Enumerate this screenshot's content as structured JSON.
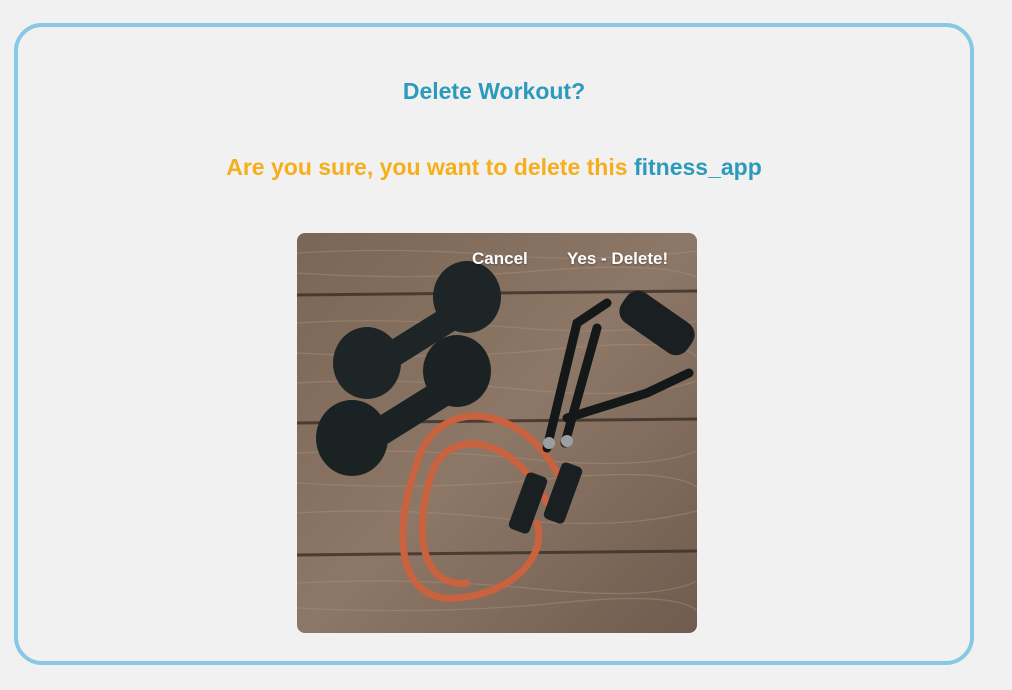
{
  "dialog": {
    "title": "Delete Workout?",
    "question_prefix": "Are you sure, you want to delete this",
    "item_name": "fitness_app",
    "image_description_icon": "dumbbells-and-resistance-band-image",
    "buttons": {
      "cancel_label": "Cancel",
      "confirm_label": "Yes - Delete!"
    }
  },
  "colors": {
    "title": "#2b9abb",
    "question": "#f7ae1b",
    "item_name": "#2b9abb",
    "border": "#87c8e4",
    "background": "#f1f1f1"
  }
}
